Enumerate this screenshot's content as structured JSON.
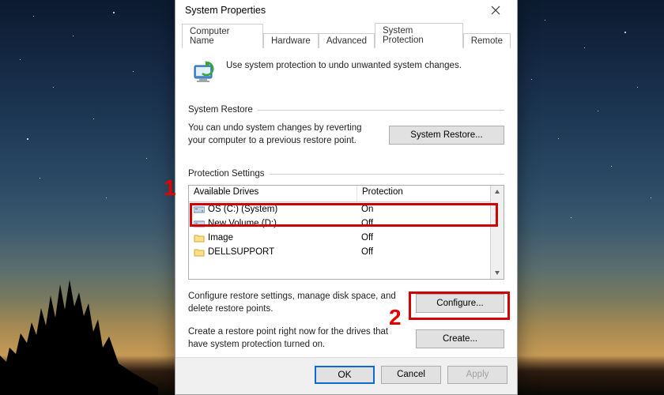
{
  "window": {
    "title": "System Properties",
    "tabs": [
      "Computer Name",
      "Hardware",
      "Advanced",
      "System Protection",
      "Remote"
    ],
    "active_tab": 3
  },
  "intro": "Use system protection to undo unwanted system changes.",
  "section_restore": {
    "title": "System Restore",
    "desc": "You can undo system changes by reverting your computer to a previous restore point.",
    "button": "System Restore..."
  },
  "section_settings": {
    "title": "Protection Settings",
    "columns": [
      "Available Drives",
      "Protection"
    ],
    "rows": [
      {
        "icon": "drive",
        "name": "OS (C:) (System)",
        "protection": "On"
      },
      {
        "icon": "drive",
        "name": "New Volume (D:)",
        "protection": "Off"
      },
      {
        "icon": "folder",
        "name": "Image",
        "protection": "Off"
      },
      {
        "icon": "folder",
        "name": "DELLSUPPORT",
        "protection": "Off"
      }
    ],
    "configure_desc": "Configure restore settings, manage disk space, and delete restore points.",
    "configure_btn": "Configure...",
    "create_desc": "Create a restore point right now for the drives that have system protection turned on.",
    "create_btn": "Create..."
  },
  "footer": {
    "ok": "OK",
    "cancel": "Cancel",
    "apply": "Apply"
  },
  "annotations": {
    "a1": "1",
    "a2": "2"
  }
}
